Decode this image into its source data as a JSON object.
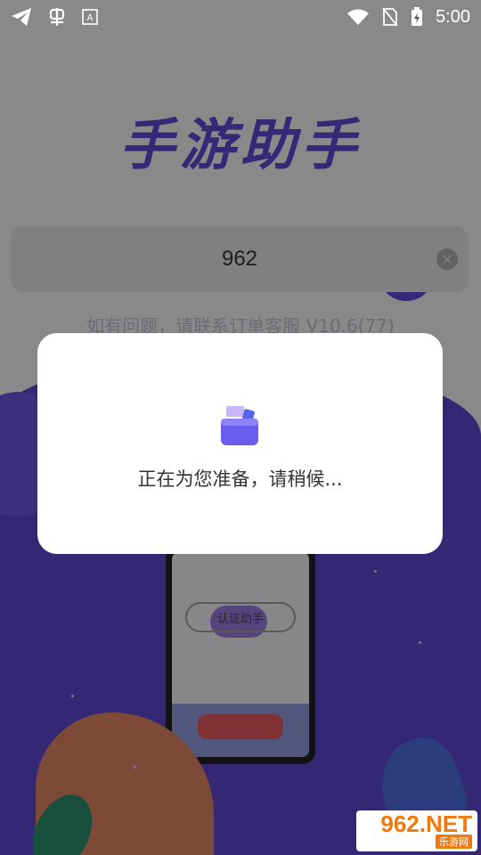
{
  "status_bar": {
    "time": "5:00",
    "icons": [
      "telegram-icon",
      "bug-icon",
      "font-icon",
      "wifi-icon",
      "no-sim-icon",
      "battery-charging-icon"
    ]
  },
  "app": {
    "title": "手游助手",
    "search": {
      "value": "962"
    },
    "hint": "如有问题，请联系订单客服 V10.6(77)",
    "auth_button_label": "认证助手"
  },
  "dialog": {
    "message": "正在为您准备，请稍候..."
  },
  "watermark": {
    "main": "962.NET",
    "sub": "乐游网"
  },
  "colors": {
    "accent": "#5a48cc",
    "overlay": "rgba(0,0,0,0.42)",
    "watermark": "#f07a0c"
  }
}
